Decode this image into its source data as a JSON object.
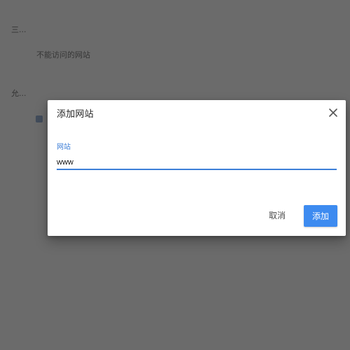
{
  "background": {
    "section1_label": "三...",
    "section1_item": "不能访问的网站",
    "section2_label": "允..."
  },
  "dialog": {
    "title": "添加网站",
    "field_label": "网站",
    "input_value": "www",
    "cancel_label": "取消",
    "add_label": "添加"
  },
  "icons": {
    "close": "close-icon"
  },
  "colors": {
    "overlay": "#6b6b6b",
    "accent": "#3d8bf0",
    "label": "#3f7fd7"
  }
}
